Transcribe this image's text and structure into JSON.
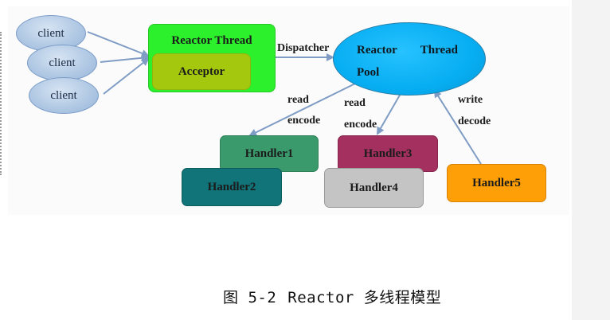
{
  "diagram": {
    "clients": [
      {
        "label": "client"
      },
      {
        "label": "client"
      },
      {
        "label": "client"
      }
    ],
    "reactor_thread": {
      "label": "Reactor Thread"
    },
    "acceptor": {
      "label": "Acceptor"
    },
    "dispatcher": {
      "label": "Dispatcher"
    },
    "thread_pool": {
      "line1_a": "Reactor",
      "line1_b": "Thread",
      "line2": "Pool"
    },
    "edge_labels": {
      "left_read": "read",
      "left_encode": "encode",
      "mid_read": "read",
      "mid_encode": "encode",
      "right_write": "write",
      "right_decode": "decode"
    },
    "handlers": [
      {
        "label": "Handler1"
      },
      {
        "label": "Handler2"
      },
      {
        "label": "Handler3"
      },
      {
        "label": "Handler4"
      },
      {
        "label": "Handler5"
      }
    ],
    "colors": {
      "client": "#a8c2e0",
      "reactor_thread": "#2bf02b",
      "acceptor": "#a4c80e",
      "thread_pool": "#07aef2",
      "handler1": "#3a9a6c",
      "handler2": "#107478",
      "handler3": "#a3305e",
      "handler4": "#c4c4c4",
      "handler5": "#ff9f07",
      "arrow": "#7f9cc4"
    }
  },
  "caption": {
    "figure": "图 5-2",
    "title": "Reactor 多线程模型"
  }
}
